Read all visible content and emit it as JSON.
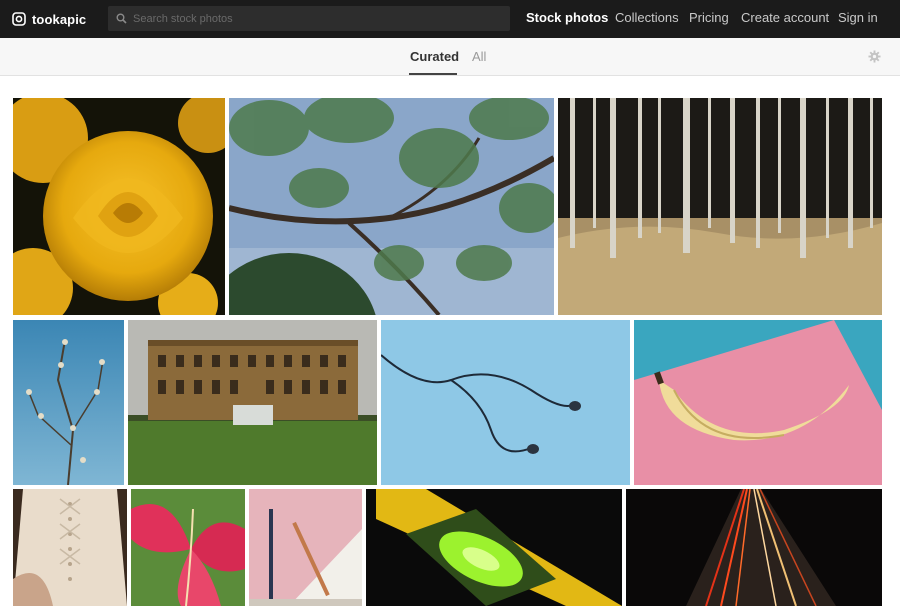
{
  "brand": {
    "name": "tookapic"
  },
  "search": {
    "placeholder": "Search stock photos",
    "icon": "search-icon"
  },
  "nav": {
    "stock_photos": "Stock photos",
    "collections": "Collections",
    "pricing": "Pricing",
    "create_account": "Create account",
    "sign_in": "Sign in"
  },
  "tabs": {
    "curated": "Curated",
    "all": "All",
    "selected": "curated"
  },
  "colors": {
    "topbar": "#1b1b1b",
    "subbar": "#f7f7f7",
    "active_text": "#ffffff",
    "muted_text": "#c9c9c9"
  },
  "photos": [
    {
      "subject": "yellow-roses"
    },
    {
      "subject": "pine-branches-sky"
    },
    {
      "subject": "birch-forest-grass"
    },
    {
      "subject": "willow-branch-sky"
    },
    {
      "subject": "stately-mansion-lawn"
    },
    {
      "subject": "earphones-blue-background"
    },
    {
      "subject": "banana-pink-blue"
    },
    {
      "subject": "wedding-dress-corset"
    },
    {
      "subject": "pink-lily"
    },
    {
      "subject": "pencil-brush-pastel"
    },
    {
      "subject": "spirit-level"
    },
    {
      "subject": "night-road-light-trails"
    }
  ]
}
